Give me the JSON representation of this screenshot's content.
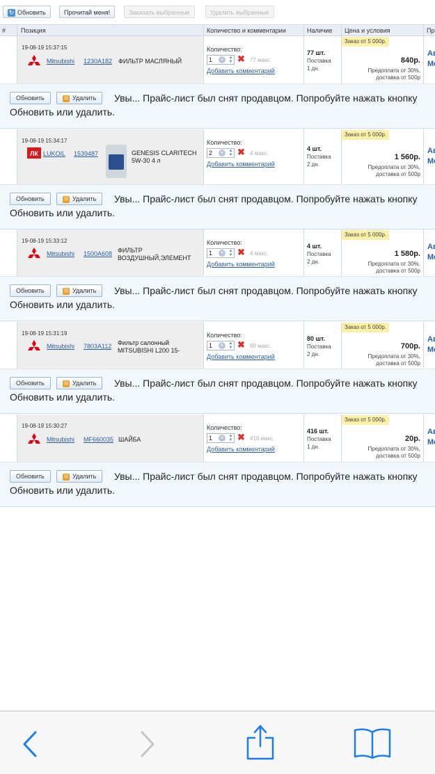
{
  "toolbar": {
    "refresh_label": "Обновить",
    "readme_label": "Прочитай меня!",
    "order_selected_label": "Заказать выбранные",
    "delete_selected_label": "Удалить выбранные"
  },
  "table_header": {
    "num": "#",
    "position": "Позиция",
    "qty_comments": "Количество и комментарии",
    "stock": "Наличие",
    "price_conditions": "Цена и условия",
    "extra": "Пр"
  },
  "items": [
    {
      "date": "19-08-19 15:37:15",
      "brand": "Mitsubishi",
      "article": "1230A182",
      "name": "ФИЛЬТР МАСЛЯНЫЙ",
      "qty_label": "Количество:",
      "qty": "1",
      "max": "77 макс.",
      "add_comment": "Добавить комментарий",
      "stock": "77 шт.",
      "delivery": "Поставка",
      "days": "1 дн.",
      "condition": "Заказ от 5 000р.",
      "price": "840р.",
      "prepay": "Предоплата от 30%,",
      "shipping": "доставка от 500р",
      "extra": "Ав\nМе"
    },
    {
      "date": "19-08-19 15:34:17",
      "brand": "LUKOIL",
      "article": "1539487",
      "name": "GENESIS CLARITECH 5W-30 4 л",
      "qty_label": "Количество:",
      "qty": "2",
      "max": "4 макс.",
      "add_comment": "Добавить комментарий",
      "stock": "4 шт.",
      "delivery": "Поставка",
      "days": "2 дн.",
      "condition": "Заказ от 5 000р.",
      "price": "1 560р.",
      "prepay": "Предоплата от 30%,",
      "shipping": "доставка от 500р",
      "extra": "Ав\nМе"
    },
    {
      "date": "19-08-19 15:33:12",
      "brand": "Mitsubishi",
      "article": "1500A608",
      "name": "ФИЛЬТР ВОЗДУШНЫЙ,ЭЛЕМЕНТ",
      "qty_label": "Количество:",
      "qty": "1",
      "max": "4 макс.",
      "add_comment": "Добавить комментарий",
      "stock": "4 шт.",
      "delivery": "Поставка",
      "days": "2 дн.",
      "condition": "Заказ от 5 000р.",
      "price": "1 580р.",
      "prepay": "Предоплата от 30%,",
      "shipping": "доставка от 500р",
      "extra": "Ав\nМе"
    },
    {
      "date": "19-08-19 15:31:19",
      "brand": "Mitsubishi",
      "article": "7803A112",
      "name": "Фильтр салонный MITSUBISHI L200 15-",
      "qty_label": "Количество:",
      "qty": "1",
      "max": "80 макс.",
      "add_comment": "Добавить комментарий",
      "stock": "80 шт.",
      "delivery": "Поставка",
      "days": "2 дн.",
      "condition": "Заказ от 5 000р.",
      "price": "700р.",
      "prepay": "Предоплата от 30%,",
      "shipping": "доставка от 500р",
      "extra": "Ав\nМе"
    },
    {
      "date": "19-08-19 15:30:27",
      "brand": "Mitsubishi",
      "article": "MF660035",
      "name": "ШАЙБА",
      "qty_label": "Количество:",
      "qty": "1",
      "max": "416 макс.",
      "add_comment": "Добавить комментарий",
      "stock": "416 шт.",
      "delivery": "Поставка",
      "days": "1 дн.",
      "condition": "Заказ от 5 000р.",
      "price": "20р.",
      "prepay": "Предоплата от 30%,",
      "shipping": "доставка от 500р",
      "extra": "Ав\nМе"
    }
  ],
  "warning": {
    "refresh_label": "Обновить",
    "delete_label": "Удалить",
    "message": "Увы... Прайс-лист был снят продавцом. Попробуйте нажать кнопку Обновить или удалить."
  },
  "colors": {
    "link": "#2a5ea8",
    "condition_bg": "#fbf0a8",
    "mitsubishi_red": "#e60012",
    "lukoil_red": "#d71920",
    "ios_blue": "#1a7cf0",
    "header_bg": "#e9eef4"
  },
  "icons": {
    "nav_back": "chevron-left-icon",
    "nav_forward": "chevron-right-icon",
    "share": "share-icon",
    "bookmarks": "book-icon"
  }
}
